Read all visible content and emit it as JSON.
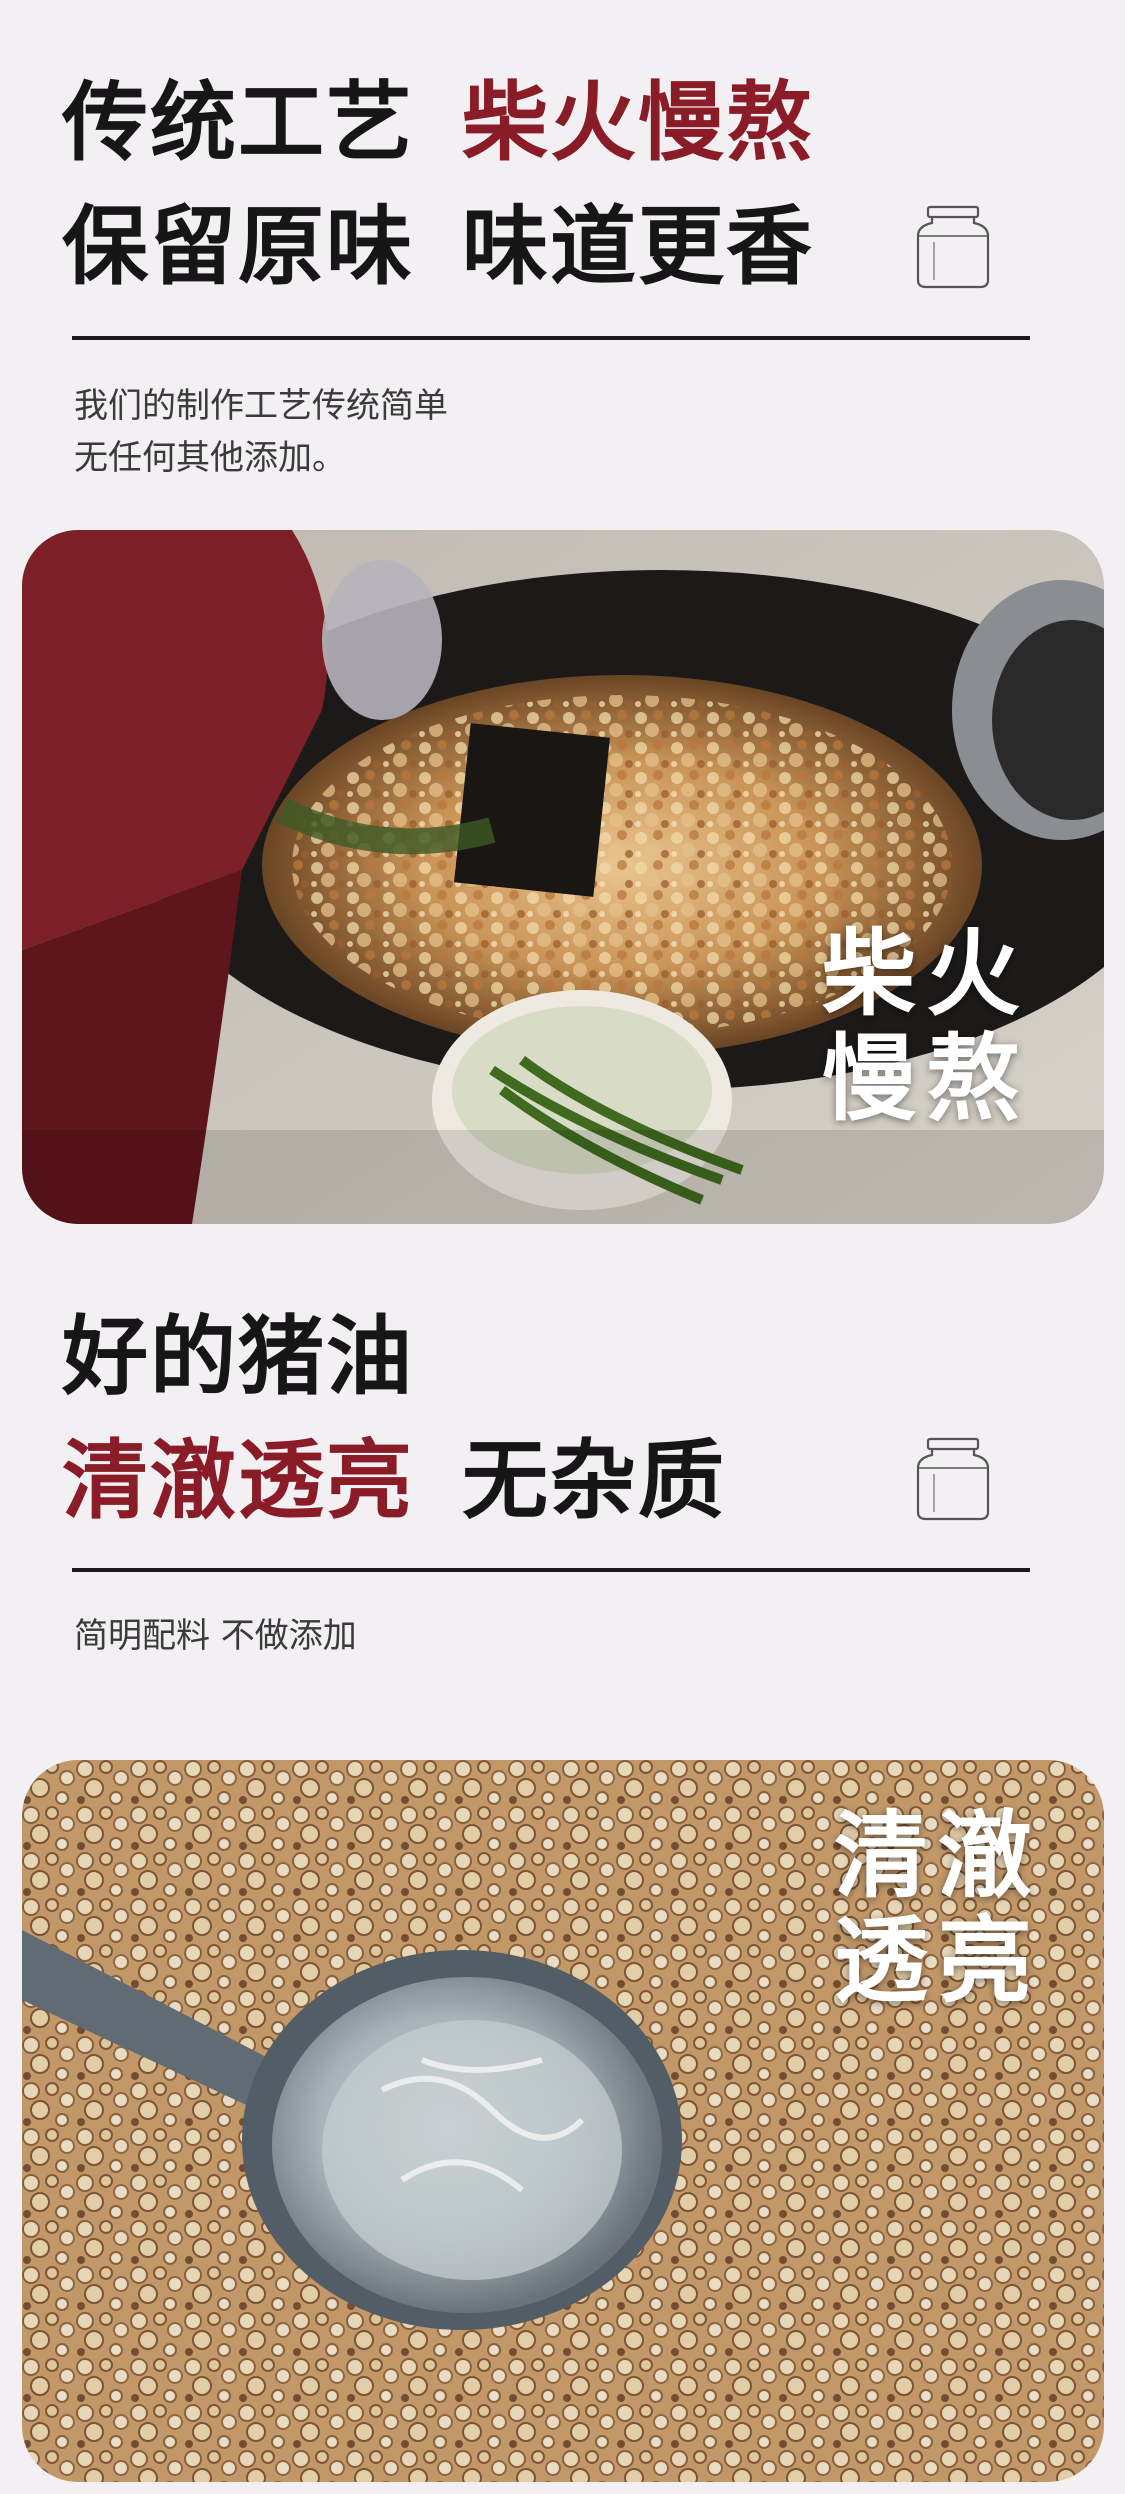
{
  "section1": {
    "heading_line1_part1": "传统工艺",
    "heading_line1_part2": "柴火慢熬",
    "heading_line2_part1": "保留原味",
    "heading_line2_part2": "味道更香",
    "description_line1": "我们的制作工艺传统简单",
    "description_line2": "无任何其他添加。",
    "photo_overlay_line1": "柴火",
    "photo_overlay_line2": "慢熬"
  },
  "section2": {
    "heading_line1": "好的猪油",
    "heading_line2_part1": "清澈透亮",
    "heading_line2_part2": "无杂质",
    "description": "简明配料 不做添加",
    "photo_overlay_line1": "清澈",
    "photo_overlay_line2": "透亮"
  },
  "icons": {
    "jar": "jar-icon"
  },
  "colors": {
    "background": "#f2f0f3",
    "heading_dark": "#161616",
    "heading_red": "#8a1c27"
  }
}
